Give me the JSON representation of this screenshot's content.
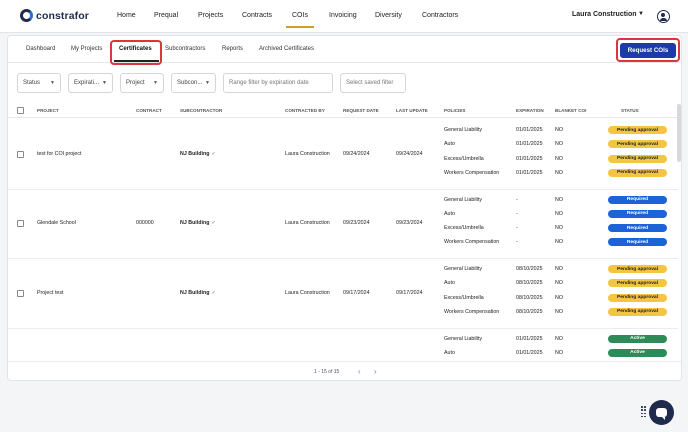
{
  "brand": {
    "logo_text": "constrafor"
  },
  "nav": {
    "items": [
      "Home",
      "Prequal",
      "Projects",
      "Contracts",
      "COIs",
      "Invoicing",
      "Diversity",
      "Contractors"
    ],
    "active": "COIs"
  },
  "account": {
    "company": "Laura Construction"
  },
  "tabs": {
    "items": [
      "Dashboard",
      "My Projects",
      "Certificates",
      "Subcontractors",
      "Reports",
      "Archived Certificates"
    ],
    "active": "Certificates"
  },
  "actions": {
    "request_label": "Request COIs"
  },
  "filters": {
    "status": "Status",
    "expiration": "Expirati...",
    "project": "Project",
    "subcontractor": "Subcon...",
    "range_placeholder": "Range filter by expiration date",
    "saved_placeholder": "Select saved filter"
  },
  "table": {
    "headers": [
      "PROJECT",
      "CONTRACT",
      "SUBCONTRACTOR",
      "CONTRACTED BY",
      "REQUEST DATE",
      "LAST UPDATE",
      "POLICIES",
      "EXPIRATION",
      "BLANKET COI",
      "STATUS"
    ],
    "rows": [
      {
        "project": "test for COI project",
        "contract": "",
        "subcontractor": "NJ Building",
        "contracted_by": "Laura Construction",
        "request_date": "09/24/2024",
        "last_update": "09/24/2024",
        "policies": [
          {
            "name": "General Liability",
            "expiration": "01/01/2025",
            "blanket": "NO",
            "status": "Pending approval",
            "kind": "pending"
          },
          {
            "name": "Auto",
            "expiration": "01/01/2025",
            "blanket": "NO",
            "status": "Pending approval",
            "kind": "pending"
          },
          {
            "name": "Excess/Umbrella",
            "expiration": "01/01/2025",
            "blanket": "NO",
            "status": "Pending approval",
            "kind": "pending"
          },
          {
            "name": "Workers Compensation",
            "expiration": "01/01/2025",
            "blanket": "NO",
            "status": "Pending approval",
            "kind": "pending"
          }
        ]
      },
      {
        "project": "Glendale School",
        "contract": "000000",
        "subcontractor": "NJ Building",
        "contracted_by": "Laura Construction",
        "request_date": "09/23/2024",
        "last_update": "09/23/2024",
        "policies": [
          {
            "name": "General Liability",
            "expiration": "-",
            "blanket": "NO",
            "status": "Required",
            "kind": "required"
          },
          {
            "name": "Auto",
            "expiration": "-",
            "blanket": "NO",
            "status": "Required",
            "kind": "required"
          },
          {
            "name": "Excess/Umbrella",
            "expiration": "-",
            "blanket": "NO",
            "status": "Required",
            "kind": "required"
          },
          {
            "name": "Workers Compensation",
            "expiration": "-",
            "blanket": "NO",
            "status": "Required",
            "kind": "required"
          }
        ]
      },
      {
        "project": "Project test",
        "contract": "",
        "subcontractor": "NJ Building",
        "contracted_by": "Laura Construction",
        "request_date": "09/17/2024",
        "last_update": "09/17/2024",
        "policies": [
          {
            "name": "General Liability",
            "expiration": "08/10/2025",
            "blanket": "NO",
            "status": "Pending approval",
            "kind": "pending"
          },
          {
            "name": "Auto",
            "expiration": "08/10/2025",
            "blanket": "NO",
            "status": "Pending approval",
            "kind": "pending"
          },
          {
            "name": "Excess/Umbrella",
            "expiration": "08/10/2025",
            "blanket": "NO",
            "status": "Pending approval",
            "kind": "pending"
          },
          {
            "name": "Workers Compensation",
            "expiration": "08/10/2025",
            "blanket": "NO",
            "status": "Pending approval",
            "kind": "pending"
          }
        ]
      },
      {
        "project": "",
        "contract": "",
        "subcontractor": "",
        "contracted_by": "",
        "request_date": "",
        "last_update": "",
        "policies": [
          {
            "name": "General Liability",
            "expiration": "01/01/2025",
            "blanket": "NO",
            "status": "Active",
            "kind": "active"
          },
          {
            "name": "Auto",
            "expiration": "01/01/2025",
            "blanket": "NO",
            "status": "Active",
            "kind": "active"
          }
        ]
      }
    ]
  },
  "pagination": {
    "text": "1 - 15 of 15"
  },
  "colors": {
    "accent": "#1d3ba8",
    "pending": "#f4c542",
    "required": "#1d63d8",
    "active": "#2e8b57",
    "highlight": "#d9363e",
    "nav_underline": "#c9a227"
  }
}
